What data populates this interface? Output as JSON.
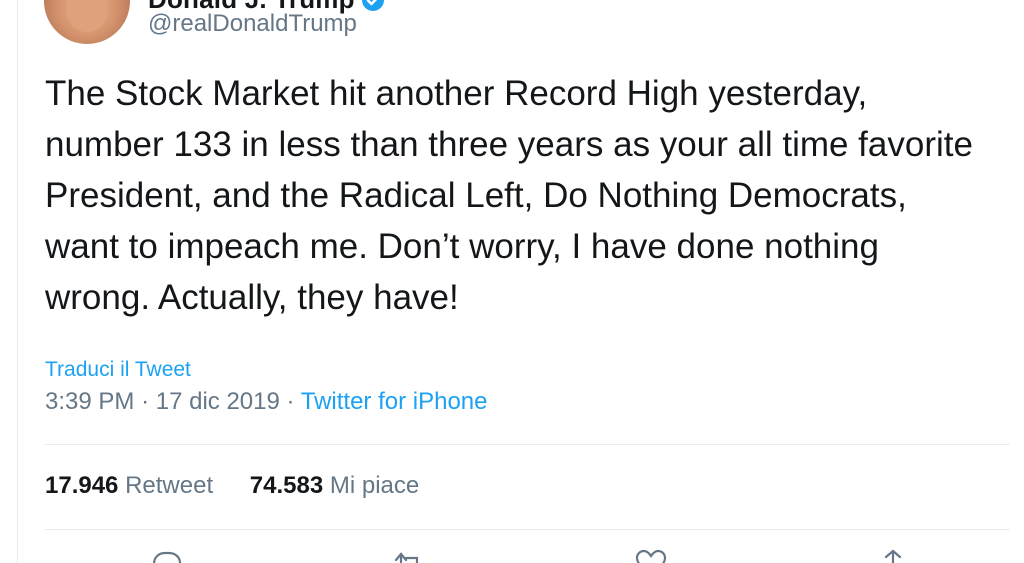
{
  "author": {
    "display_name": "Donald J. Trump",
    "handle": "@realDonaldTrump",
    "verified": true
  },
  "tweet": {
    "text": "The Stock Market hit another Record High yesterday, number 133 in less than three years as your all time favorite President, and the Radical Left, Do Nothing Democrats, want to impeach me. Don’t worry, I have done nothing wrong. Actually, they have!",
    "translate_label": "Traduci il Tweet",
    "time": "3:39 PM",
    "date": "17 dic 2019",
    "separator": "·",
    "source": "Twitter for iPhone"
  },
  "stats": {
    "retweets_count": "17.946",
    "retweets_label": "Retweet",
    "likes_count": "74.583",
    "likes_label": "Mi piace"
  },
  "actions": [
    {
      "icon": "reply-icon"
    },
    {
      "icon": "retweet-icon"
    },
    {
      "icon": "like-icon"
    },
    {
      "icon": "share-icon"
    }
  ],
  "colors": {
    "link": "#1da1f2",
    "secondary_text": "#657786",
    "primary_text": "#14171a",
    "divider": "#e6ecf0"
  }
}
